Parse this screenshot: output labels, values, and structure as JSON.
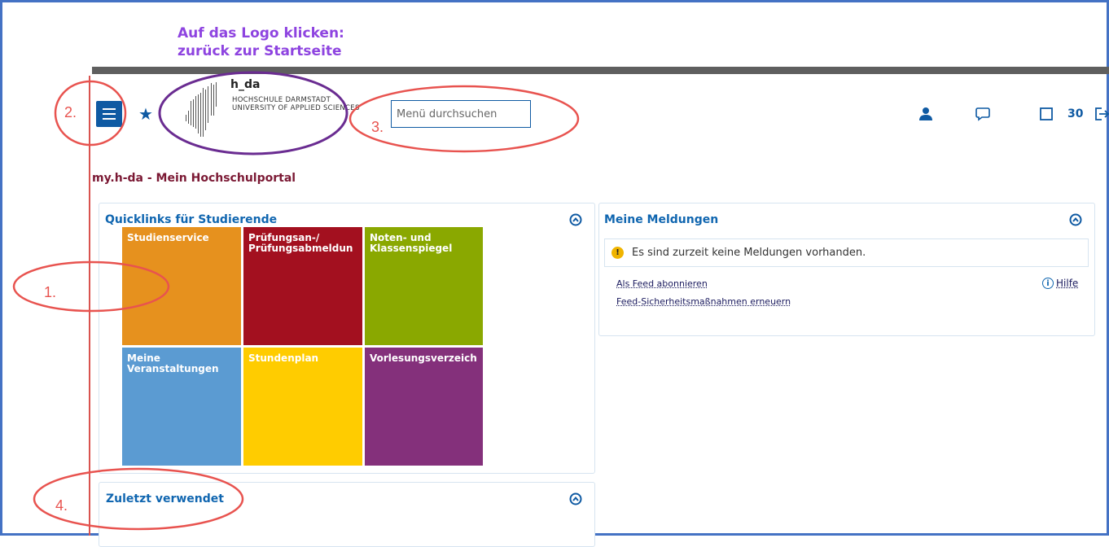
{
  "annotation": {
    "title_line1": "Auf das Logo klicken:",
    "title_line2": "zurück zur Startseite",
    "markers": [
      "1.",
      "2.",
      "3.",
      "4."
    ]
  },
  "header": {
    "logo": {
      "brand": "h_da",
      "line1": "HOCHSCHULE DARMSTADT",
      "line2": "UNIVERSITY OF APPLIED SCIENCES"
    },
    "search": {
      "placeholder": "Menü durchsuchen"
    },
    "icons": [
      "user-icon",
      "chat-icon",
      "checkbox-icon",
      "logout-icon"
    ],
    "count": "30"
  },
  "portal_title": "my.h-da - Mein Hochschulportal",
  "quicklinks": {
    "title": "Quicklinks für Studierende",
    "tiles": [
      {
        "label": "Studienservice",
        "color": "#e6911e"
      },
      {
        "label": "Prüfungsan-/\nPrüfungsabmeldun",
        "color": "#a3101f"
      },
      {
        "label": "Noten- und\nKlassenspiegel",
        "color": "#8aa800"
      },
      {
        "label": "Meine\nVeranstaltungen",
        "color": "#5b9bd2"
      },
      {
        "label": "Stundenplan",
        "color": "#ffcc00"
      },
      {
        "label": "Vorlesungsverzeich",
        "color": "#84307b"
      }
    ]
  },
  "recent": {
    "title": "Zuletzt verwendet"
  },
  "messages": {
    "title": "Meine Meldungen",
    "info_text": "Es sind zurzeit keine Meldungen vorhanden.",
    "feed_link": "Als Feed abonnieren",
    "security_link": "Feed-Sicherheitsmaßnahmen erneuern",
    "help_label": "Hilfe"
  },
  "colors": {
    "accent": "#0f5aa3",
    "title_link": "#1066b0",
    "portal_title": "#7b1934",
    "annotation_red": "#e8534f",
    "annotation_purple": "#6a2c91",
    "annotation_text": "#8e44e0"
  }
}
